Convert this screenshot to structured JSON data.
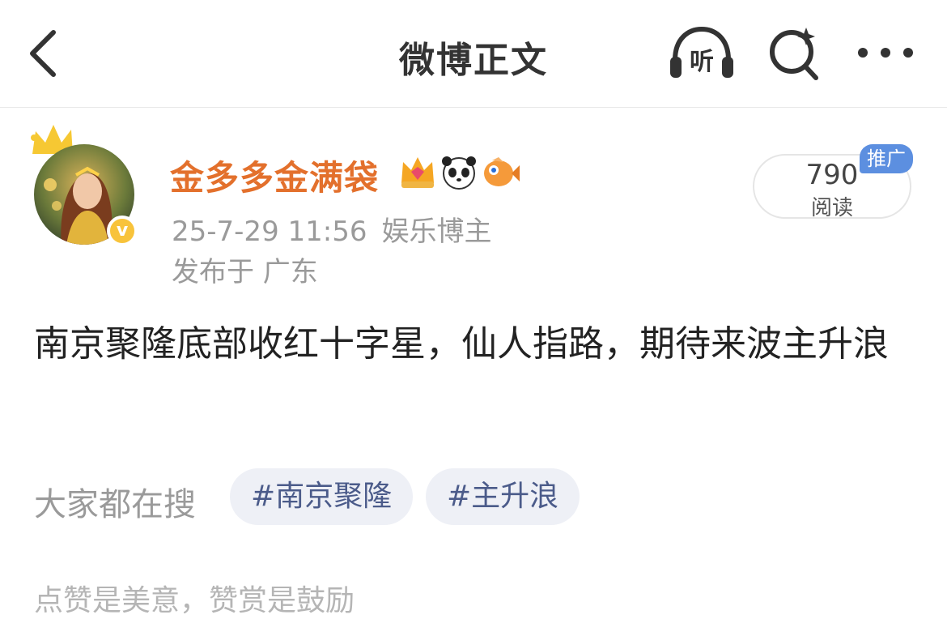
{
  "header": {
    "title": "微博正文",
    "listen_label": "听"
  },
  "post": {
    "username": "金多多金满袋",
    "verified_label": "v",
    "date": "25-7-29 11:56",
    "author_role": "娱乐博主",
    "location": "发布于 广东",
    "reads_count": "790",
    "reads_label": "阅读",
    "promo_label": "推广",
    "content": "南京聚隆底部收红十字星，仙人指路，期待来波主升浪"
  },
  "search_section": {
    "label": "大家都在搜",
    "tags": [
      "#南京聚隆",
      "#主升浪"
    ]
  },
  "footer": {
    "hint": "点赞是美意，赞赏是鼓励"
  },
  "colors": {
    "username": "#e3702c",
    "tag_text": "#4b5b8a",
    "tag_bg": "#eef0f6",
    "promo_bg": "#5c8fe0",
    "verified_badge": "#f8c33b"
  }
}
